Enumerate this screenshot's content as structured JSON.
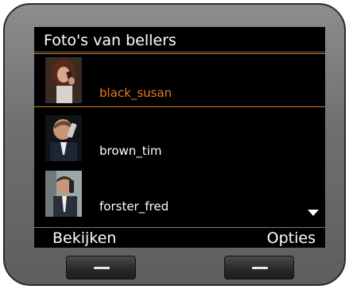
{
  "screen": {
    "title": "Foto's van bellers"
  },
  "contacts": [
    {
      "name": "black_susan",
      "selected": true
    },
    {
      "name": "brown_tim",
      "selected": false
    },
    {
      "name": "forster_fred",
      "selected": false
    }
  ],
  "softkeys": {
    "left_label": "Bekijken",
    "right_label": "Opties"
  },
  "colors": {
    "highlight": "#e57a22",
    "screen_background": "#000000",
    "device_body": "#707070"
  },
  "icons": {
    "scroll": "scroll-down-arrow-icon",
    "softkey": "softkey-dash-icon"
  }
}
